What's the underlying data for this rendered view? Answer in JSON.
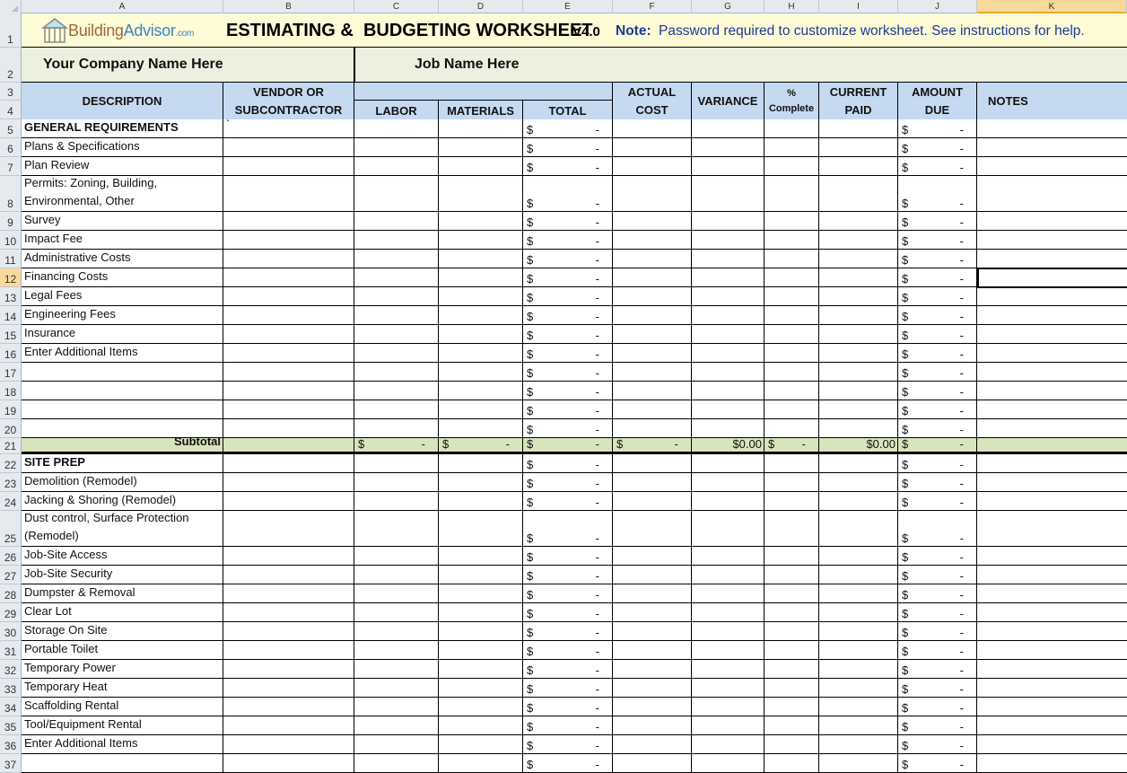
{
  "spreadsheet": {
    "columns": [
      "A",
      "B",
      "C",
      "D",
      "E",
      "F",
      "G",
      "H",
      "I",
      "J",
      "K"
    ],
    "selected_column": "K",
    "selected_row": "12",
    "selected_cell": "K12"
  },
  "banner": {
    "logo": {
      "part1": "Building",
      "part2": "Advisor",
      "part3": ".com",
      "icon": "house-icon"
    },
    "title": "ESTIMATING &  BUDGETING WORKSHEET",
    "version": "V4.0",
    "note_label": "Note:",
    "note_text": "Password required to customize worksheet. See instructions for help.",
    "company_name": "Your Company Name Here",
    "job_name": "Job Name Here"
  },
  "headers": {
    "description": "DESCRIPTION",
    "vendor": "VENDOR  OR\nSUBCONTRACTOR",
    "labor": "LABOR",
    "materials": "MATERIALS",
    "total": "TOTAL",
    "actual_cost": "ACTUAL\nCOST",
    "variance": "VARIANCE",
    "pct_complete_top": "%",
    "pct_complete_bottom": "Complete",
    "current_paid": "CURRENT\nPAID",
    "amount_due": "AMOUNT\nDUE",
    "notes": "NOTES"
  },
  "currency": {
    "symbol": "$",
    "empty": "-"
  },
  "rows": [
    {
      "num": "5",
      "desc": "GENERAL REQUIREMENTS",
      "type": "section",
      "vendor": "`"
    },
    {
      "num": "6",
      "desc": "Plans & Specifications",
      "type": "item"
    },
    {
      "num": "7",
      "desc": "Plan Review",
      "type": "item"
    },
    {
      "num": "8",
      "desc": "Permits: Zoning, Building,\nEnvironmental, Other",
      "type": "item",
      "tall": true
    },
    {
      "num": "9",
      "desc": "Survey",
      "type": "item"
    },
    {
      "num": "10",
      "desc": "Impact Fee",
      "type": "item"
    },
    {
      "num": "11",
      "desc": "Administrative Costs",
      "type": "item"
    },
    {
      "num": "12",
      "desc": "Financing Costs",
      "type": "item"
    },
    {
      "num": "13",
      "desc": "Legal Fees",
      "type": "item"
    },
    {
      "num": "14",
      "desc": "Engineering Fees",
      "type": "item"
    },
    {
      "num": "15",
      "desc": "Insurance",
      "type": "item"
    },
    {
      "num": "16",
      "desc": "Enter Additional Items",
      "type": "item"
    },
    {
      "num": "17",
      "desc": "",
      "type": "item"
    },
    {
      "num": "18",
      "desc": "",
      "type": "item"
    },
    {
      "num": "19",
      "desc": "",
      "type": "item"
    },
    {
      "num": "20",
      "desc": "",
      "type": "item"
    },
    {
      "num": "21",
      "desc": "Subtotal",
      "type": "subtotal",
      "variance": "$0.00",
      "current_paid": "$0.00"
    },
    {
      "num": "22",
      "desc": "SITE PREP",
      "type": "section"
    },
    {
      "num": "23",
      "desc": "Demolition (Remodel)",
      "type": "item"
    },
    {
      "num": "24",
      "desc": "Jacking & Shoring (Remodel)",
      "type": "item"
    },
    {
      "num": "25",
      "desc": "Dust control, Surface Protection\n(Remodel)",
      "type": "item",
      "tall": true
    },
    {
      "num": "26",
      "desc": "Job-Site Access",
      "type": "item"
    },
    {
      "num": "27",
      "desc": "Job-Site Security",
      "type": "item"
    },
    {
      "num": "28",
      "desc": "Dumpster & Removal",
      "type": "item"
    },
    {
      "num": "29",
      "desc": "Clear Lot",
      "type": "item"
    },
    {
      "num": "30",
      "desc": "Storage On Site",
      "type": "item"
    },
    {
      "num": "31",
      "desc": "Portable Toilet",
      "type": "item"
    },
    {
      "num": "32",
      "desc": "Temporary Power",
      "type": "item"
    },
    {
      "num": "33",
      "desc": "Temporary Heat",
      "type": "item"
    },
    {
      "num": "34",
      "desc": "Scaffolding Rental",
      "type": "item"
    },
    {
      "num": "35",
      "desc": "Tool/Equipment Rental",
      "type": "item"
    },
    {
      "num": "36",
      "desc": "Enter Additional Items",
      "type": "item"
    },
    {
      "num": "37",
      "desc": "",
      "type": "item"
    }
  ]
}
